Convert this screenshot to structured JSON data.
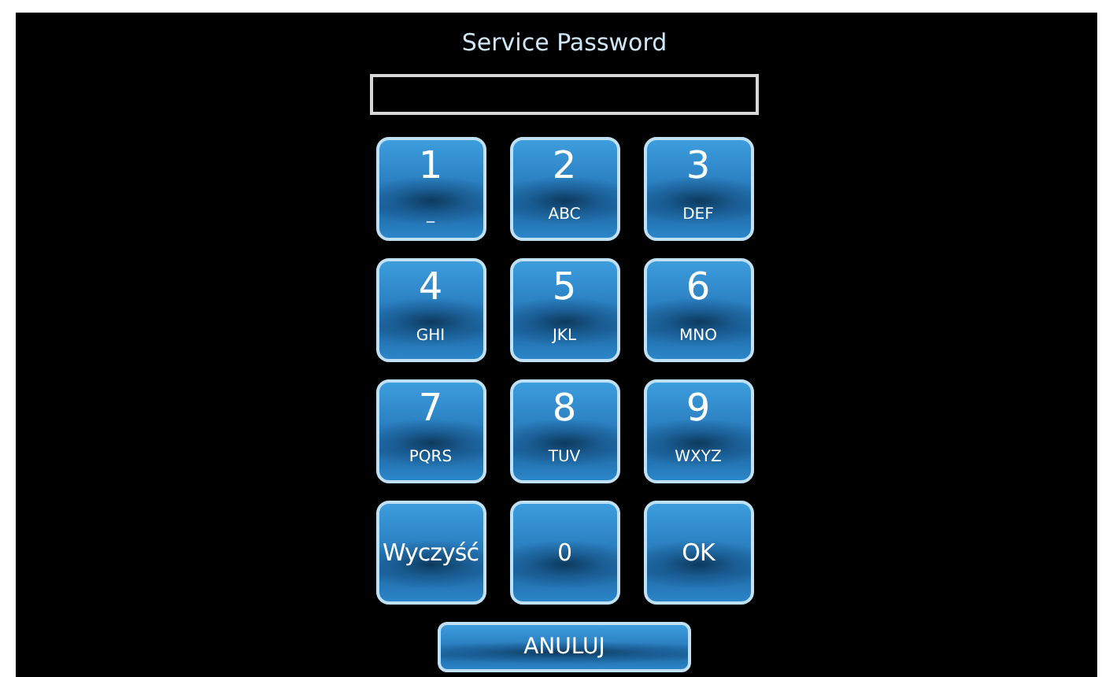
{
  "title": "Service Password",
  "keys": [
    {
      "kind": "digit",
      "label": "1",
      "sub": "_"
    },
    {
      "kind": "digit",
      "label": "2",
      "sub": "ABC"
    },
    {
      "kind": "digit",
      "label": "3",
      "sub": "DEF"
    },
    {
      "kind": "digit",
      "label": "4",
      "sub": "GHI"
    },
    {
      "kind": "digit",
      "label": "5",
      "sub": "JKL"
    },
    {
      "kind": "digit",
      "label": "6",
      "sub": "MNO"
    },
    {
      "kind": "digit",
      "label": "7",
      "sub": "PQRS"
    },
    {
      "kind": "digit",
      "label": "8",
      "sub": "TUV"
    },
    {
      "kind": "digit",
      "label": "9",
      "sub": "WXYZ"
    },
    {
      "kind": "action",
      "label": "Wyczyść"
    },
    {
      "kind": "action",
      "label": "0"
    },
    {
      "kind": "action",
      "label": "OK"
    }
  ],
  "cancel_button": "ANULUJ"
}
